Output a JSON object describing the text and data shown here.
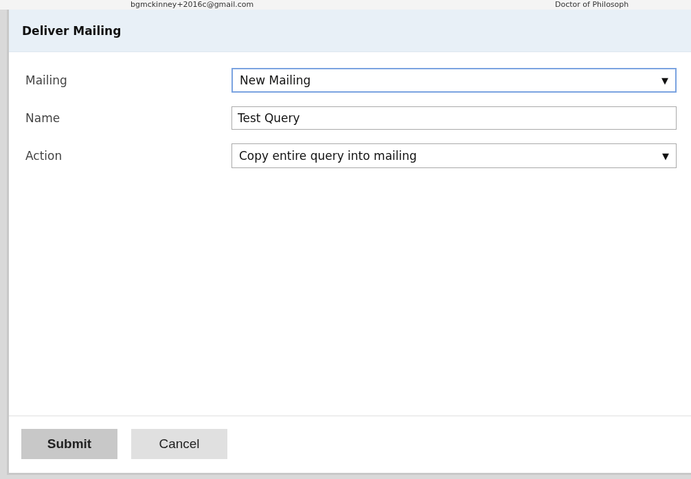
{
  "background": {
    "email": "bgmckinney+2016c@gmail.com",
    "degree": "Doctor of Philosoph"
  },
  "dialog": {
    "title": "Deliver Mailing",
    "fields": [
      {
        "kind": "select",
        "label": "Mailing",
        "value": "New Mailing",
        "focused": true,
        "arrow": "▼"
      },
      {
        "kind": "text",
        "label": "Name",
        "value": "Test Query",
        "focused": false
      },
      {
        "kind": "select",
        "label": "Action",
        "value": "Copy entire query into mailing",
        "focused": false,
        "arrow": "▼"
      }
    ],
    "buttons": [
      {
        "label": "Submit",
        "kind": "primary"
      },
      {
        "label": "Cancel",
        "kind": "secondary"
      }
    ]
  }
}
